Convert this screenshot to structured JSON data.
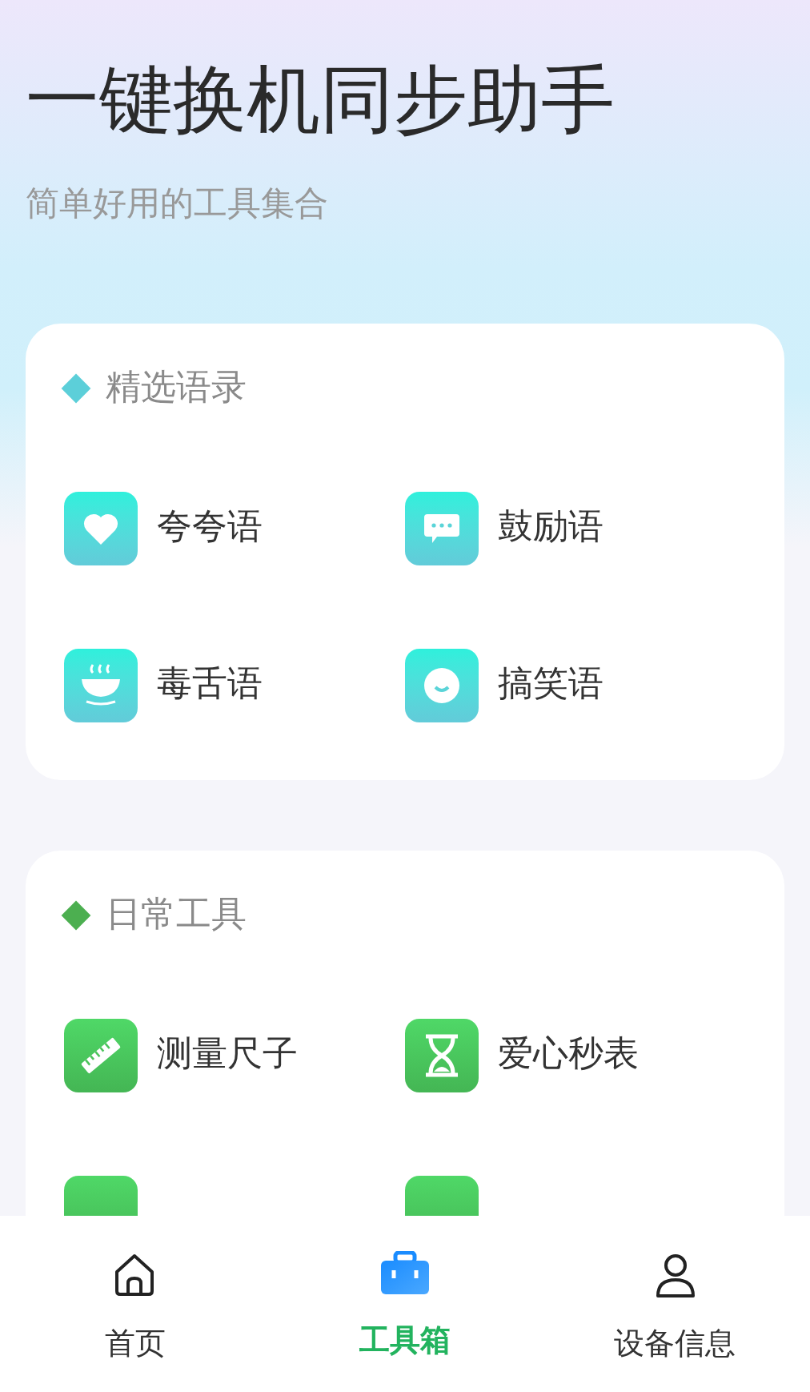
{
  "header": {
    "title": "一键换机同步助手",
    "subtitle": "简单好用的工具集合"
  },
  "sections": [
    {
      "title": "精选语录",
      "color": "#5ccfd9",
      "kind": "teal",
      "items": [
        {
          "kind": "tool",
          "label": "夸夸语"
        },
        {
          "kind": "tool",
          "label": "鼓励语"
        },
        {
          "kind": "tool",
          "label": "毒舌语"
        },
        {
          "kind": "tool",
          "label": "搞笑语"
        }
      ]
    },
    {
      "title": "日常工具",
      "color": "#4caf50",
      "kind": "green",
      "items": [
        {
          "kind": "tool",
          "label": "测量尺子"
        },
        {
          "kind": "tool",
          "label": "爱心秒表"
        },
        {
          "kind": "cut-off"
        },
        {
          "kind": "cut-off"
        }
      ]
    }
  ],
  "bottom_nav": [
    {
      "label": "首页",
      "selected": false
    },
    {
      "label": "工具箱",
      "selected": true
    },
    {
      "label": "设备信息",
      "selected": false
    }
  ]
}
